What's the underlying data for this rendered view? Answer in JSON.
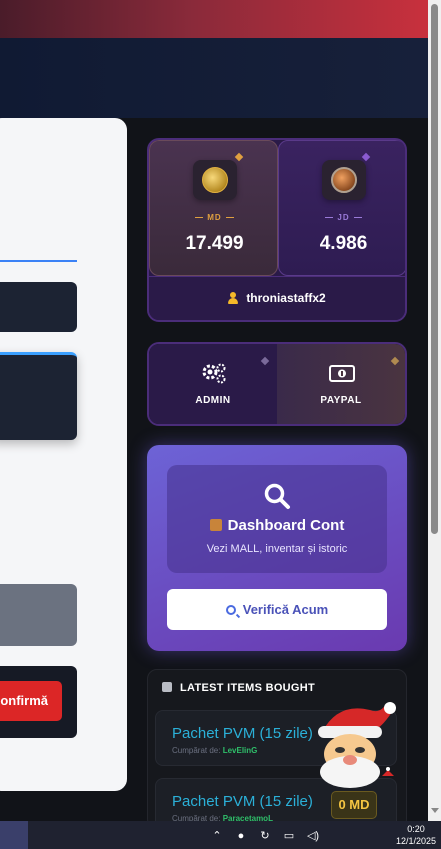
{
  "currency": {
    "md": {
      "label": "MD",
      "value": "17.499",
      "icon": "gold-coin-icon",
      "color": "#e0a040"
    },
    "jd": {
      "label": "JD",
      "value": "4.986",
      "icon": "jd-coin-icon",
      "color": "#9a7ad8"
    },
    "username": "throniastaffx2"
  },
  "actions": {
    "admin": {
      "label": "ADMIN",
      "icon": "gears-icon"
    },
    "paypal": {
      "label": "PAYPAL",
      "icon": "banknote-icon"
    }
  },
  "dashboard": {
    "title": "Dashboard Cont",
    "subtitle": "Vezi MALL, inventar și istoric",
    "button": "Verifică Acum"
  },
  "latest": {
    "heading": "LATEST ITEMS BOUGHT",
    "items": [
      {
        "name": "Pachet PVM (15 zile)",
        "buyer_prefix": "Cumpărat de:",
        "buyer": "LevElinG",
        "price": ""
      },
      {
        "name": "Pachet PVM (15 zile)",
        "buyer_prefix": "Cumpărat de:",
        "buyer": "ParacetamoL",
        "price": "0 MD"
      }
    ]
  },
  "left_form": {
    "confirm_button": "onfirmă"
  },
  "taskbar": {
    "time": "0:20",
    "date": "12/1/2025"
  },
  "colors": {
    "accent": "#6d63d6",
    "panel_border": "#4b2d7a",
    "confirm": "#dc2626",
    "item_name": "#2bb0d8",
    "buyer": "#2fbf6a",
    "price": "#f5c542"
  }
}
